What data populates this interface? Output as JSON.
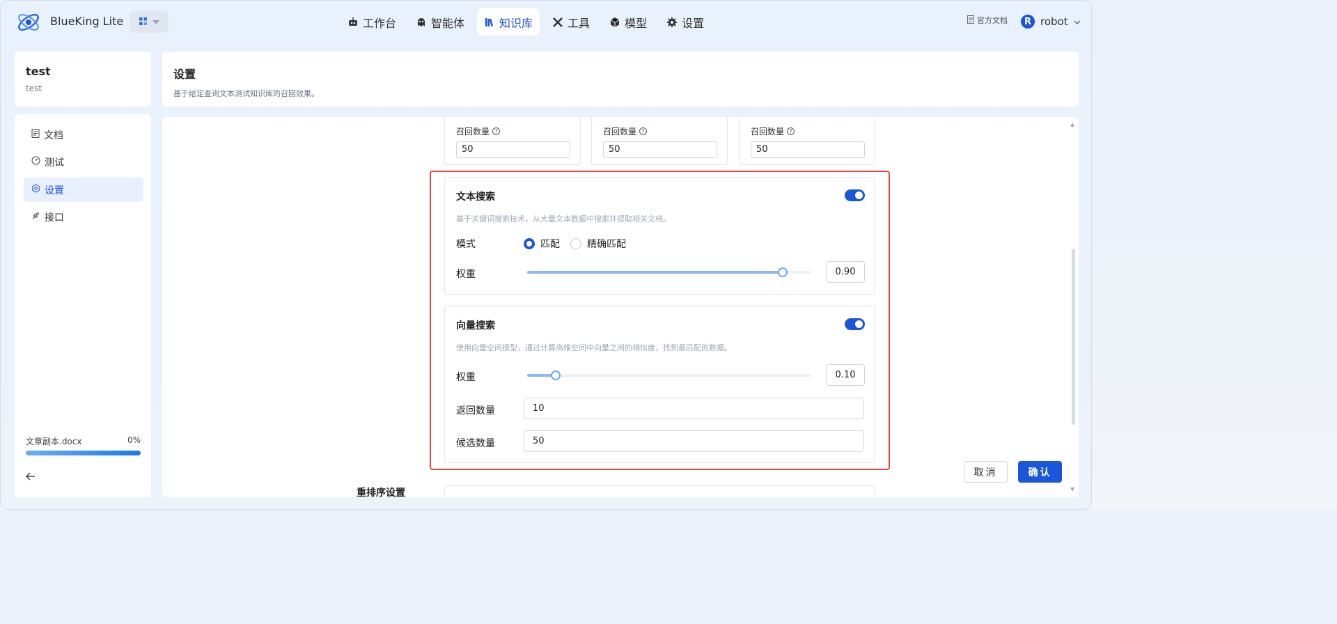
{
  "app": {
    "brand": "BlueKing Lite"
  },
  "nav": {
    "items": [
      {
        "label": "工作台",
        "icon": "robot-icon"
      },
      {
        "label": "智能体",
        "icon": "ghost-icon"
      },
      {
        "label": "知识库",
        "icon": "library-icon",
        "active": true
      },
      {
        "label": "工具",
        "icon": "tools-icon"
      },
      {
        "label": "模型",
        "icon": "cube-icon"
      },
      {
        "label": "设置",
        "icon": "gear-icon"
      }
    ]
  },
  "header": {
    "doc_link": "官方文档",
    "user_initial": "R",
    "user_name": "robot"
  },
  "knowledge_base": {
    "title": "test",
    "subtitle": "test"
  },
  "sidebar": {
    "items": [
      {
        "label": "文档",
        "icon": "document-icon"
      },
      {
        "label": "测试",
        "icon": "gauge-icon"
      },
      {
        "label": "设置",
        "icon": "gear-icon",
        "active": true
      },
      {
        "label": "接口",
        "icon": "plug-icon"
      }
    ]
  },
  "upload": {
    "file": "文章副本.docx",
    "progress_label": "0%",
    "progress": 0
  },
  "page": {
    "title": "设置",
    "desc": "基于给定查询文本测试知识库的召回效果。"
  },
  "recall": [
    {
      "label": "召回数量",
      "value": "50"
    },
    {
      "label": "召回数量",
      "value": "50"
    },
    {
      "label": "召回数量",
      "value": "50"
    }
  ],
  "text_search": {
    "title": "文本搜索",
    "enabled": true,
    "desc": "基于关键词搜索技术，从大量文本数据中搜索并提取相关文档。",
    "mode_label": "模式",
    "modes": [
      "匹配",
      "精确匹配"
    ],
    "mode_selected": "匹配",
    "weight_label": "权重",
    "weight": "0.90",
    "weight_value": 0.9
  },
  "vector_search": {
    "title": "向量搜索",
    "enabled": true,
    "desc": "使用向量空间模型，通过计算高维空间中向量之间的相似度，找到最匹配的数据。",
    "weight_label": "权重",
    "weight": "0.10",
    "weight_value": 0.1,
    "return_label": "返回数量",
    "return_value": "10",
    "candidate_label": "候选数量",
    "candidate_value": "50"
  },
  "rerank": {
    "title": "重排序设置"
  },
  "actions": {
    "cancel": "取消",
    "confirm": "确认"
  },
  "colors": {
    "accent": "#1a56db",
    "highlight_border": "#e5463f"
  }
}
